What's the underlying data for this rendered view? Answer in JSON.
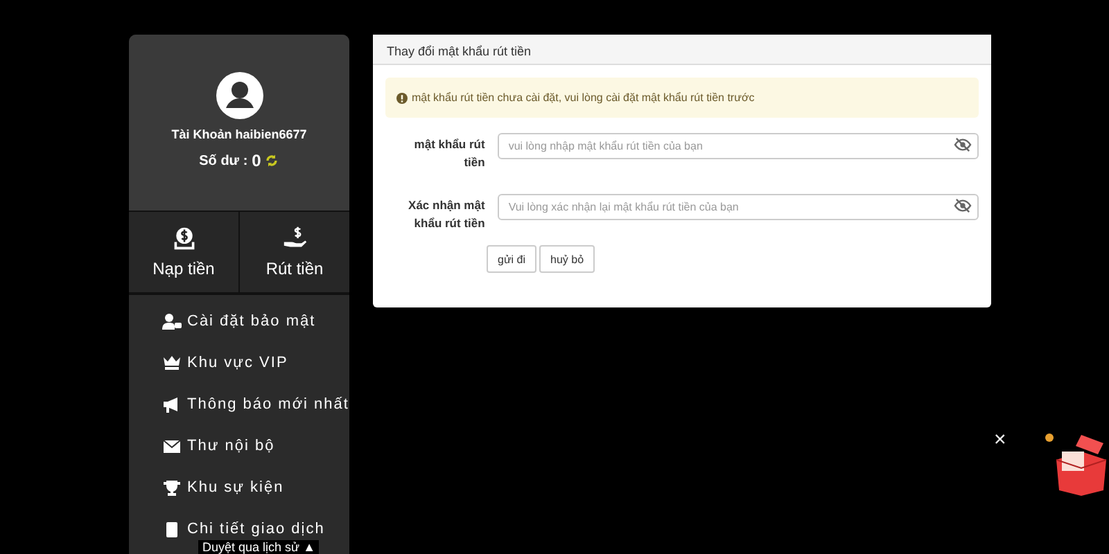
{
  "profile": {
    "account": "Tài Khoản haibien6677",
    "balance_label": "Số dư :",
    "balance": "0"
  },
  "actions": [
    {
      "label": "Nạp tiền",
      "kind": "deposit"
    },
    {
      "label": "Rút tiền",
      "kind": "withdraw"
    }
  ],
  "menu": [
    {
      "label": "Cài đặt bảo mật",
      "kind": "security"
    },
    {
      "label": "Khu vực VIP",
      "kind": "vip"
    },
    {
      "label": "Thông báo mới nhất",
      "kind": "notice"
    },
    {
      "label": "Thư nội bộ",
      "kind": "mail"
    },
    {
      "label": "Khu sự kiện",
      "kind": "event"
    },
    {
      "label": "Chi tiết giao dịch",
      "kind": "history"
    }
  ],
  "tooltip": "Duyệt qua lịch sử",
  "tooltip_icon": "▲",
  "panel": {
    "title": "Thay đổi mật khẩu rút tiền",
    "alert": "mật khẩu rút tiền chưa cài đặt, vui lòng cài đặt mật khẩu rút tiền trước",
    "fields": [
      {
        "label": "mật khẩu rút tiền",
        "placeholder": "vui lòng nhập mật khẩu rút tiền của bạn"
      },
      {
        "label": "Xác nhận mật khẩu rút tiền",
        "placeholder": "Vui lòng xác nhận lại mật khẩu rút tiền của bạn"
      }
    ],
    "buttons": [
      "gửi đi",
      "huỷ bỏ"
    ]
  },
  "close": "×"
}
